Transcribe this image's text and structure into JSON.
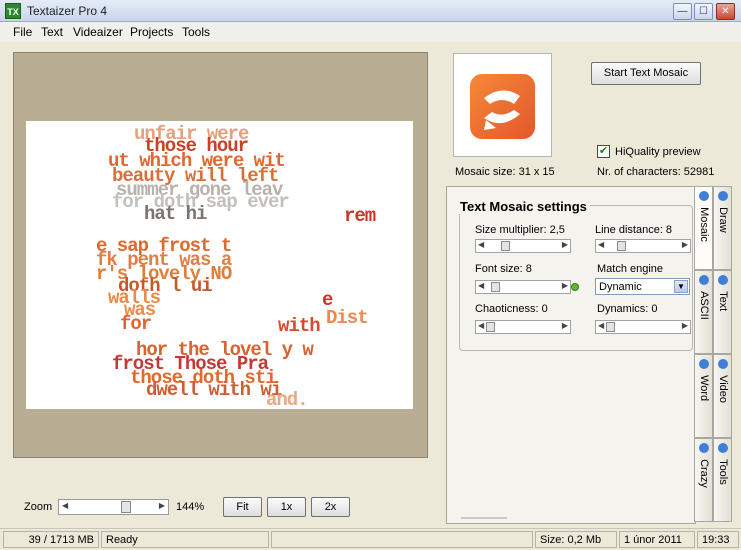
{
  "window": {
    "title": "Textaizer Pro 4",
    "icon_text": "TX",
    "minimize_glyph": "—",
    "maximize_glyph": "☐",
    "close_glyph": "✕"
  },
  "menu": [
    "File",
    "Text",
    "Videaizer",
    "Projects",
    "Tools"
  ],
  "mosaic_lines": [
    {
      "text": "unfair were",
      "color": "#e8a07c"
    },
    {
      "text": "those hour",
      "color": "#c9402a"
    },
    {
      "text": "ut which were wit",
      "color": "#e0672f"
    },
    {
      "text": "beauty will left",
      "color": "#d8703a"
    },
    {
      "text": "summer gone leav",
      "color": "#b8b2ab"
    },
    {
      "text": "for doth sap ever",
      "color": "#c2c0bc"
    },
    {
      "text": "hat hi",
      "color": "#7a7370"
    },
    {
      "text": "rem",
      "color": "#c43a26"
    },
    {
      "text": "e sap frost t",
      "color": "#e2692a"
    },
    {
      "text": "fk pent was a",
      "color": "#e07f45"
    },
    {
      "text": "r's lovely NO",
      "color": "#e07e38"
    },
    {
      "text": "doth l ui",
      "color": "#c45a2c"
    },
    {
      "text": "walls",
      "color": "#e88a4a"
    },
    {
      "text": "was",
      "color": "#ea8d4c"
    },
    {
      "text": "e",
      "color": "#c8352a"
    },
    {
      "text": "for",
      "color": "#e0652c"
    },
    {
      "text": "with",
      "color": "#d84a2e"
    },
    {
      "text": "Dist",
      "color": "#ea8a52"
    },
    {
      "text": "hor the lovel y w",
      "color": "#d9622f"
    },
    {
      "text": "frost Those Pra",
      "color": "#c23a35"
    },
    {
      "text": "those doth sti",
      "color": "#e2682c"
    },
    {
      "text": "dwell with wi",
      "color": "#d05c32"
    },
    {
      "text": "and.",
      "color": "#e8a882"
    }
  ],
  "zoom": {
    "label": "Zoom",
    "value": "144%",
    "fit_label": "Fit",
    "one_x_label": "1x",
    "two_x_label": "2x"
  },
  "actions": {
    "start_label": "Start Text Mosaic"
  },
  "info": {
    "mosaic_size": "Mosaic size: 31 x 15",
    "hiquality_label": "HiQuality preview",
    "hiquality_checked": true,
    "nr_characters": "Nr. of characters: 52981"
  },
  "settings": {
    "title": "Text Mosaic settings",
    "size_multiplier": "Size multiplier: 2,5",
    "line_distance": "Line distance: 8",
    "font_size": "Font size: 8",
    "match_engine_label": "Match engine",
    "match_engine_value": "Dynamic",
    "chaoticness": "Chaoticness: 0",
    "dynamics": "Dynamics: 0"
  },
  "tabs": {
    "mosaic": "Mosaic",
    "draw": "Draw",
    "ascii": "ASCII",
    "text": "Text",
    "word": "Word",
    "video": "Video",
    "crazy": "Crazy",
    "tools": "Tools"
  },
  "status": {
    "memory": "39 / 1713 MB",
    "state": "Ready",
    "size": "Size: 0,2 Mb",
    "date": "1 únor 2011",
    "time": "19:33"
  },
  "colors": {
    "accent_orange": "#e4562a",
    "checkbox_check": "#1b7f1b"
  }
}
